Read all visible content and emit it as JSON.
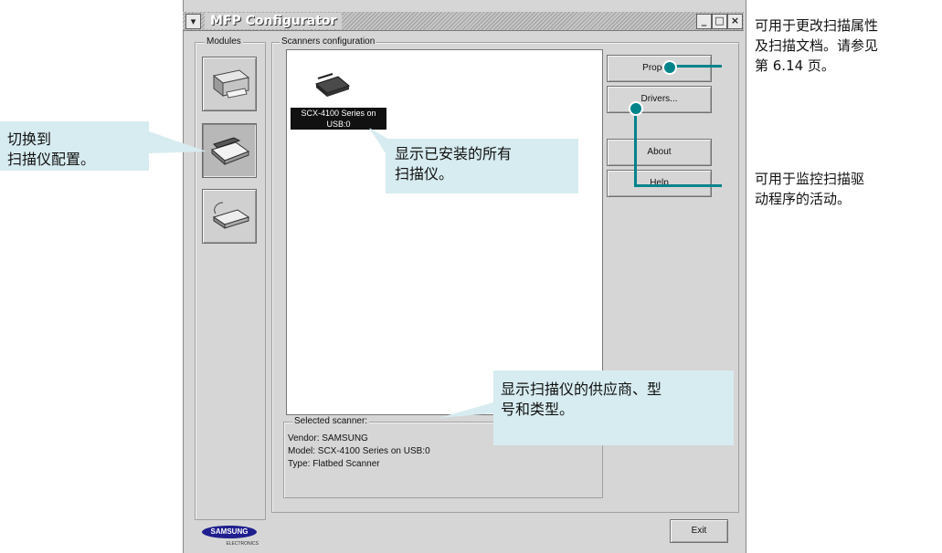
{
  "window": {
    "title": "MFP Configurator",
    "menu_icon": "chevron-down-icon",
    "min_label": "_",
    "max_label": "□",
    "close_label": "×"
  },
  "modules": {
    "label": "Modules",
    "items": [
      {
        "name": "printer"
      },
      {
        "name": "scanner"
      },
      {
        "name": "port"
      }
    ]
  },
  "scanners": {
    "label": "Scanners configuration",
    "list": [
      {
        "label": "SCX-4100 Series on USB:0"
      }
    ],
    "selected": {
      "label": "Selected scanner:",
      "vendor": "Vendor: SAMSUNG",
      "model": "Model: SCX-4100 Series on USB:0",
      "type": "Type: Flatbed Scanner"
    }
  },
  "buttons": {
    "properties": "Prope…",
    "drivers": "Drivers...",
    "about": "About",
    "help": "Help",
    "exit": "Exit"
  },
  "brand": {
    "logo": "SAMSUNG",
    "sub": "ELECTRONICS"
  },
  "callouts": {
    "switch": [
      "切换到",
      "扫描仪配置。"
    ],
    "installed": [
      "显示已安装的所有",
      "扫描仪。"
    ],
    "vendor_info": [
      "显示扫描仪的供应商、型",
      "号和类型。"
    ]
  },
  "notes": {
    "properties": [
      "可用于更改扫描属性",
      "及扫描文档。请参见",
      "第 6.14 页。"
    ],
    "drivers": [
      "可用于监控扫描驱",
      "动程序的活动。"
    ]
  },
  "colors": {
    "accent": "#00848a",
    "callout": "#d7ecf0",
    "window": "#d6d6d6"
  }
}
